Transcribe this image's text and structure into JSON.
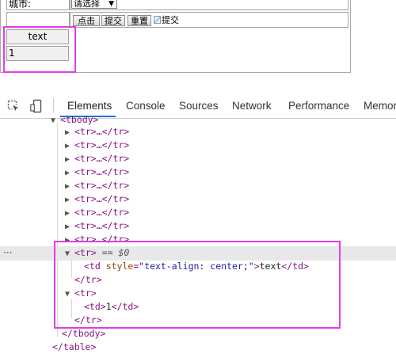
{
  "form": {
    "city_label": "城市:",
    "select_value": "请选择",
    "buttons": [
      "点击",
      "提交",
      "重置"
    ],
    "image_button_alt": "提交"
  },
  "table": {
    "header_cell": "text",
    "data_cell": "1"
  },
  "devtools": {
    "tabs": [
      "Elements",
      "Console",
      "Sources",
      "Network",
      "Performance",
      "Memor"
    ],
    "active_tab": "Elements",
    "tree": {
      "tbody_open": "<tbody>",
      "collapsed_row": "<tr>…</tr>",
      "selected_row_open": "<tr>",
      "selected_marker": "== $0",
      "td_text_tag_open": "<td ",
      "style_attr": "style",
      "style_value": "\"text-align: center;\"",
      "td_text_content": "text",
      "td_close": "</td>",
      "tr_close": "</tr>",
      "tr_open": "<tr>",
      "td_open": "<td>",
      "td_one_content": "1",
      "tbody_close": "</tbody>",
      "table_close": "</table>"
    }
  }
}
